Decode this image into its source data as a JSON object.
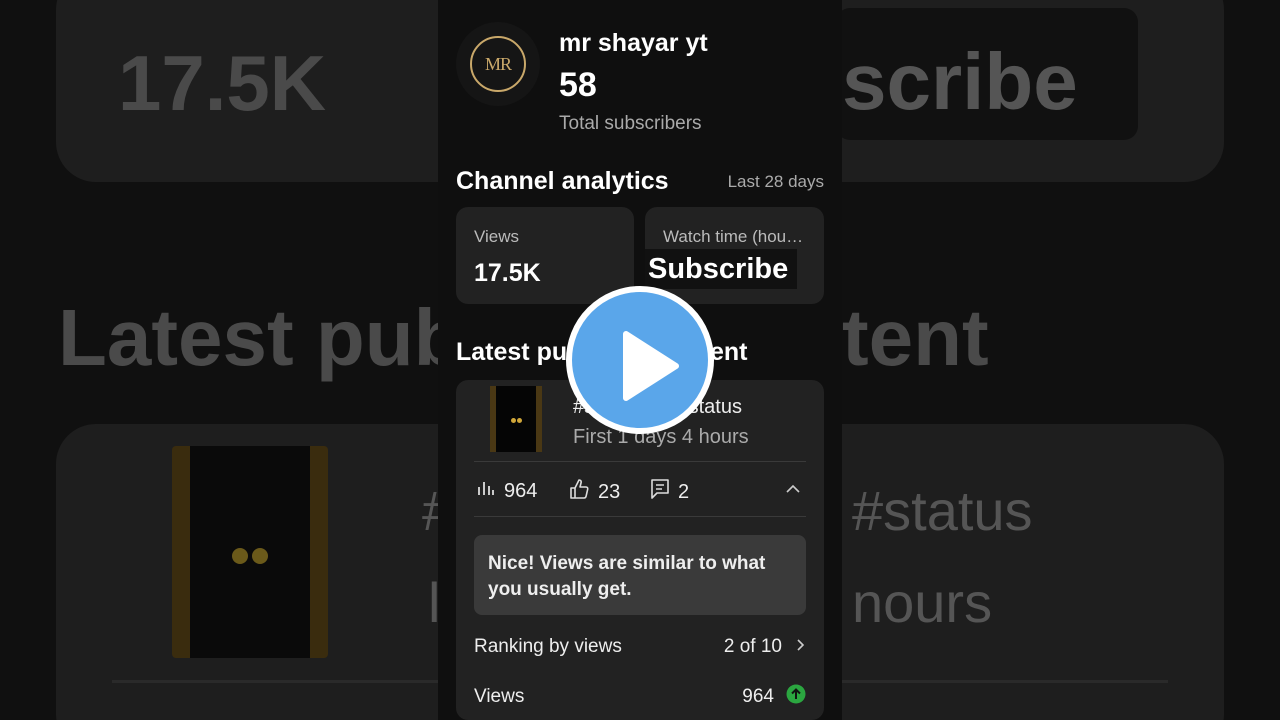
{
  "background": {
    "views_value": "17.5K",
    "subscribe_label": "scribe",
    "latest_left": "Latest pub",
    "latest_right": "tent",
    "hashtag": "#status",
    "hours_left": "l",
    "hours_right": "nours",
    "hash_left": "#"
  },
  "channel": {
    "name": "mr shayar yt",
    "avatar_text": "MR",
    "subscribers": "58",
    "subscribers_label": "Total subscribers"
  },
  "analytics": {
    "title": "Channel analytics",
    "range": "Last 28 days",
    "views_label": "Views",
    "views_value": "17.5K",
    "watch_label": "Watch time (hou…",
    "subscribe_overlay": "Subscribe"
  },
  "latest": {
    "title_left": "Latest pub",
    "title_right": "ent",
    "video_title": "#s            n #status",
    "video_subtitle": "First 1 days 4 hours",
    "views": "964",
    "likes": "23",
    "comments": "2",
    "note": "Nice! Views are similar to what you usually get.",
    "ranking_label": "Ranking by views",
    "ranking_value": "2 of 10",
    "views_label": "Views",
    "views_value": "964"
  },
  "colors": {
    "accent_play": "#5aa6ea",
    "up_badge": "#2ba640",
    "avatar_gold": "#c9a86a"
  },
  "icons": [
    "bar-chart-icon",
    "thumbs-up-icon",
    "comment-icon",
    "chevron-up-icon",
    "chevron-right-icon",
    "arrow-up-circle-icon",
    "play-icon"
  ]
}
